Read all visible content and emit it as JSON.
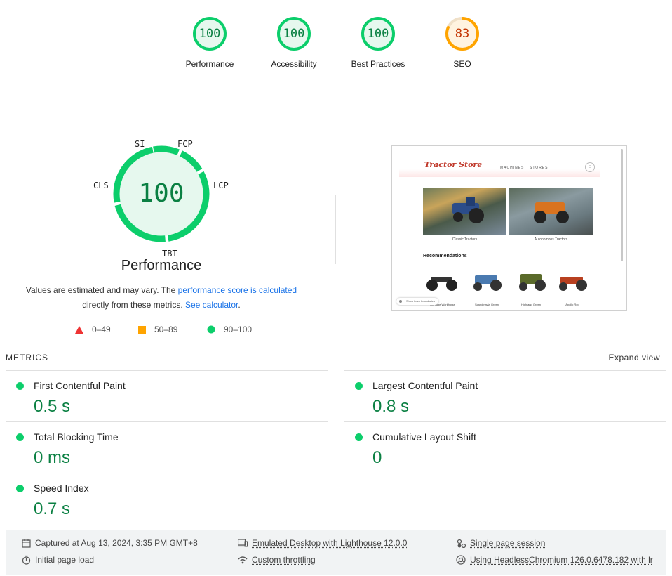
{
  "top_gauges": [
    {
      "score": "100",
      "label": "Performance",
      "status": "pass"
    },
    {
      "score": "100",
      "label": "Accessibility",
      "status": "pass"
    },
    {
      "score": "100",
      "label": "Best Practices",
      "status": "pass"
    },
    {
      "score": "83",
      "label": "SEO",
      "status": "average"
    }
  ],
  "performance": {
    "score": "100",
    "title": "Performance",
    "sub_labels": {
      "si": "SI",
      "fcp": "FCP",
      "lcp": "LCP",
      "tbt": "TBT",
      "cls": "CLS"
    },
    "note_prefix": "Values are estimated and may vary. The ",
    "note_link1": "performance score is calculated",
    "note_mid": " directly from these metrics. ",
    "note_link2": "See calculator",
    "note_suffix": "."
  },
  "legend": [
    {
      "range": "0–49",
      "shape": "triangle",
      "color": "#e33"
    },
    {
      "range": "50–89",
      "shape": "square",
      "color": "#ffa400"
    },
    {
      "range": "90–100",
      "shape": "circle",
      "color": "#0cce6b"
    }
  ],
  "preview": {
    "logo": "Tractor Store",
    "nav": [
      "MACHINES",
      "STORES"
    ],
    "cards": [
      "Classic Tractors",
      "Autonomous Tractors"
    ],
    "recommendations_title": "Recommendations",
    "tractor_captions": [
      "Heritage Workhorse",
      "Scandinavia Green",
      "Highland Green",
      "Apollo Red"
    ],
    "toggle_label": "Show team boundaries"
  },
  "metrics": {
    "header": "METRICS",
    "expand": "Expand view",
    "items": [
      {
        "name": "First Contentful Paint",
        "value": "0.5 s"
      },
      {
        "name": "Largest Contentful Paint",
        "value": "0.8 s"
      },
      {
        "name": "Total Blocking Time",
        "value": "0 ms"
      },
      {
        "name": "Cumulative Layout Shift",
        "value": "0"
      },
      {
        "name": "Speed Index",
        "value": "0.7 s"
      }
    ]
  },
  "footer": {
    "captured": "Captured at Aug 13, 2024, 3:35 PM GMT+8",
    "emulated": "Emulated Desktop with Lighthouse 12.0.0",
    "session": "Single page session",
    "load": "Initial page load",
    "throttling": "Custom throttling",
    "browser": "Using HeadlessChromium 126.0.6478.182 with lr"
  },
  "colors": {
    "pass": "#0cce6b",
    "pass_text": "#0b8043",
    "average": "#ffa400",
    "average_text": "#c33300"
  }
}
